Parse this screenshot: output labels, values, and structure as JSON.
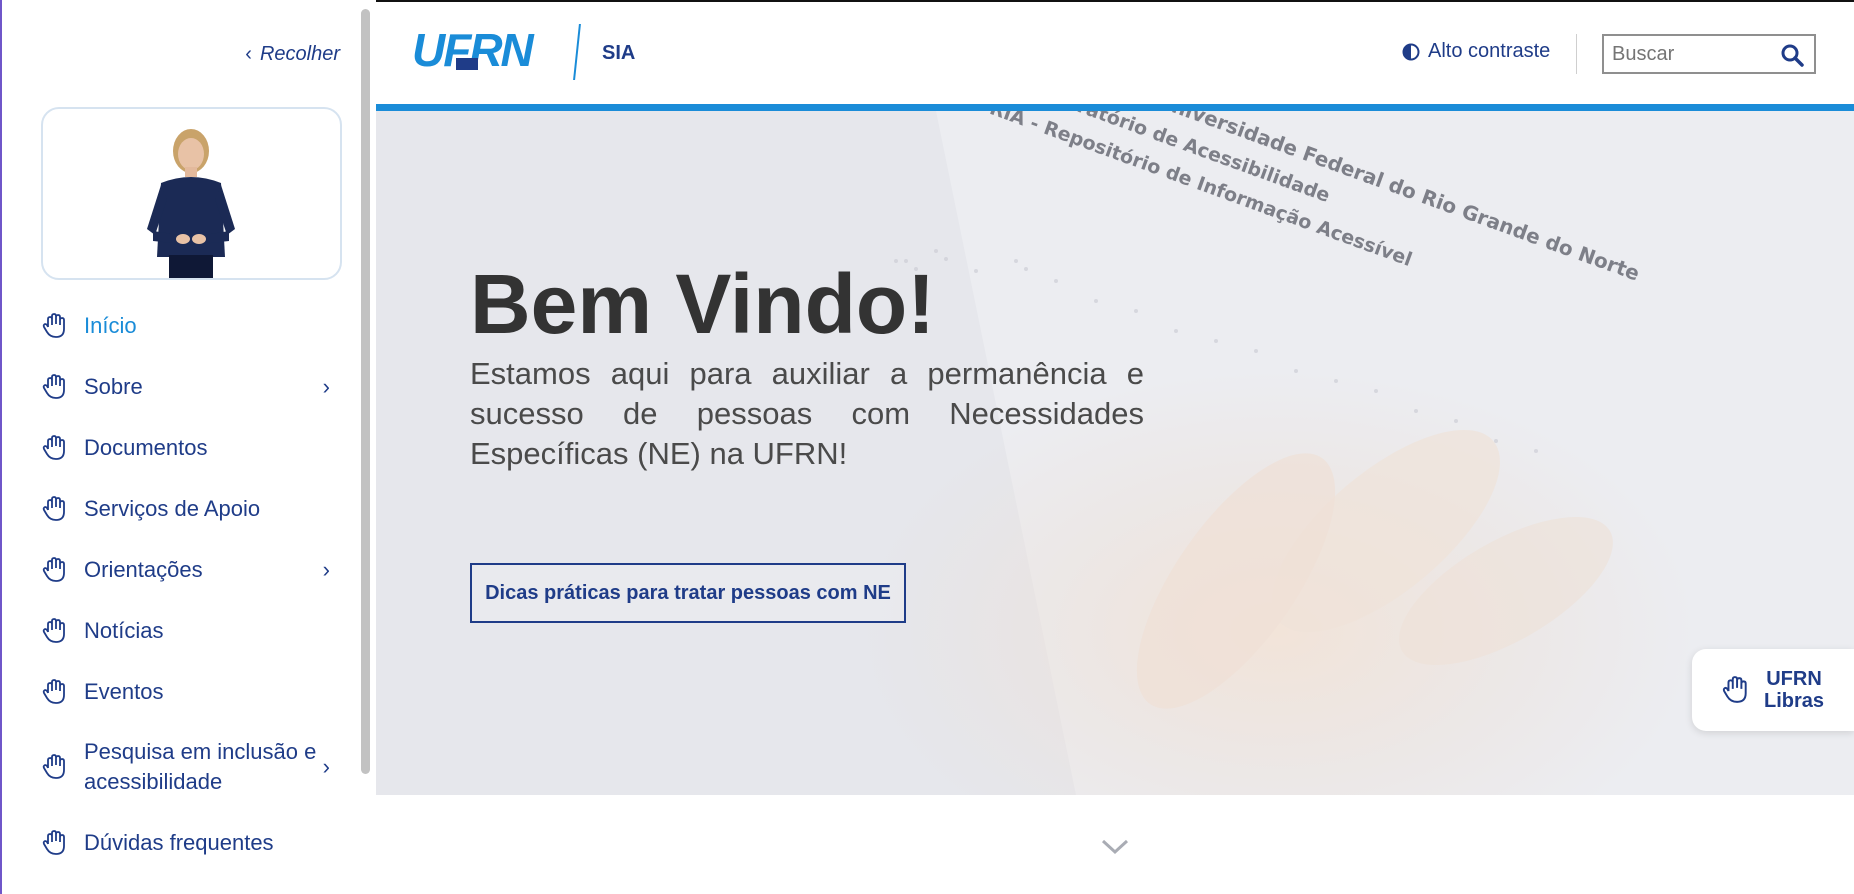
{
  "sidebar": {
    "collapse_label": "Recolher",
    "items": [
      {
        "label": "Início",
        "active": true,
        "has_submenu": false
      },
      {
        "label": "Sobre",
        "active": false,
        "has_submenu": true
      },
      {
        "label": "Documentos",
        "active": false,
        "has_submenu": false
      },
      {
        "label": "Serviços de Apoio",
        "active": false,
        "has_submenu": false
      },
      {
        "label": "Orientações",
        "active": false,
        "has_submenu": true
      },
      {
        "label": "Notícias",
        "active": false,
        "has_submenu": false
      },
      {
        "label": "Eventos",
        "active": false,
        "has_submenu": false
      },
      {
        "label": "Pesquisa em inclusão e acessibilidade",
        "active": false,
        "has_submenu": true
      },
      {
        "label": "Dúvidas frequentes",
        "active": false,
        "has_submenu": false
      }
    ]
  },
  "header": {
    "logo_text": "UFRN",
    "site_acronym": "SIA",
    "contrast_label": "Alto contraste",
    "search": {
      "placeholder": "Buscar",
      "value": ""
    }
  },
  "hero": {
    "title": "Bem Vindo!",
    "subtitle": "Estamos aqui para auxiliar a permanência e sucesso de pessoas com Necessidades Específicas (NE) na UFRN!",
    "button_label": "Dicas práticas para tratar pessoas com NE",
    "background_text": [
      "UFRN  -  Universidade Federal do Rio Grande do Norte",
      "Laboratório de Acessibilidade",
      "RIA  -  Repositório de Informação Acessível"
    ]
  },
  "libras_tab": {
    "line1": "UFRN",
    "line2": "Libras"
  },
  "colors": {
    "primary": "#1f3c88",
    "accent": "#1a8cd8",
    "text_dark": "#333333"
  },
  "icons": {
    "nav": "sign-language-hand-icon",
    "collapse": "chevron-left-icon",
    "submenu": "chevron-right-icon",
    "contrast": "contrast-icon",
    "search": "search-icon",
    "scroll": "chevron-down-icon"
  }
}
